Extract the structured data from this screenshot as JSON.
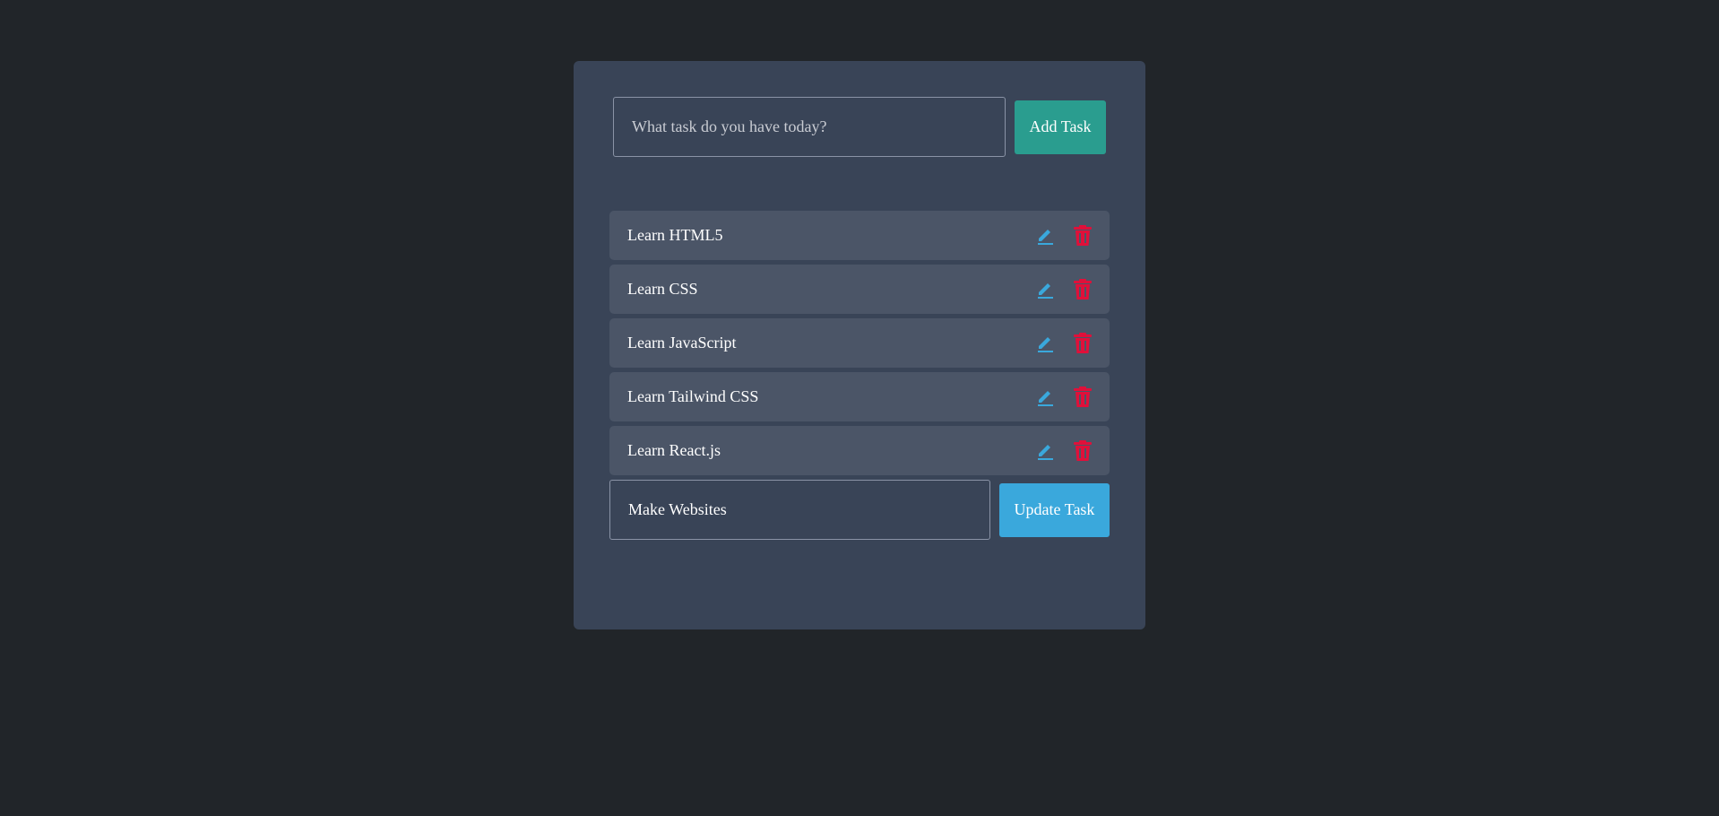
{
  "add_form": {
    "placeholder": "What task do you have today?",
    "button_label": "Add Task"
  },
  "tasks": [
    {
      "label": "Learn HTML5"
    },
    {
      "label": "Learn CSS"
    },
    {
      "label": "Learn JavaScript"
    },
    {
      "label": "Learn Tailwind CSS"
    },
    {
      "label": "Learn React.js"
    }
  ],
  "edit_form": {
    "value": "Make Websites",
    "button_label": "Update Task"
  },
  "icons": {
    "edit": "pencil-icon",
    "delete": "trash-icon"
  },
  "colors": {
    "background": "#212529",
    "card": "#394457",
    "task_item": "#4b5567",
    "add_button": "#2a9d8f",
    "update_button": "#3aa8dc",
    "edit_icon": "#3aa8dc",
    "delete_icon": "#e0103a"
  }
}
